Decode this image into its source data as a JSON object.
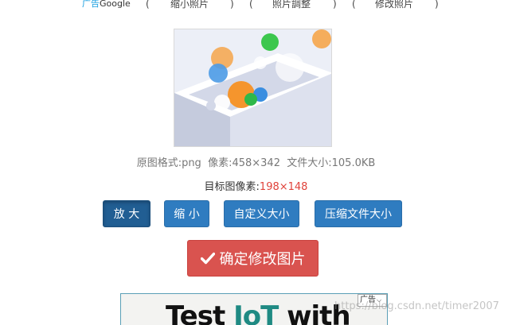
{
  "topnav": {
    "ad_label": "广告",
    "ad_google": "Google",
    "items": [
      "(",
      "缩小照片",
      ")",
      "(",
      "照片調整",
      ")",
      "(",
      "修改照片",
      ")"
    ]
  },
  "image_info": {
    "format_label": "原图格式:png",
    "pixel_label": "像素:458×342",
    "size_label": "文件大小:105.0KB"
  },
  "target": {
    "label": "目标图像素:",
    "value": "198×148"
  },
  "buttons": {
    "zoom_in": "放 大",
    "zoom_out": "缩 小",
    "custom_size": "自定义大小",
    "compress": "压缩文件大小",
    "confirm": "确定修改图片"
  },
  "ad": {
    "headline_pre": "Test ",
    "headline_highlight": "IoT",
    "headline_post": " with",
    "tag": "广告"
  },
  "watermark": "https://blog.csdn.net/timer2007",
  "colors": {
    "primary": "#2f7cc0",
    "danger": "#d9534f",
    "highlight_red": "#e0433b"
  }
}
